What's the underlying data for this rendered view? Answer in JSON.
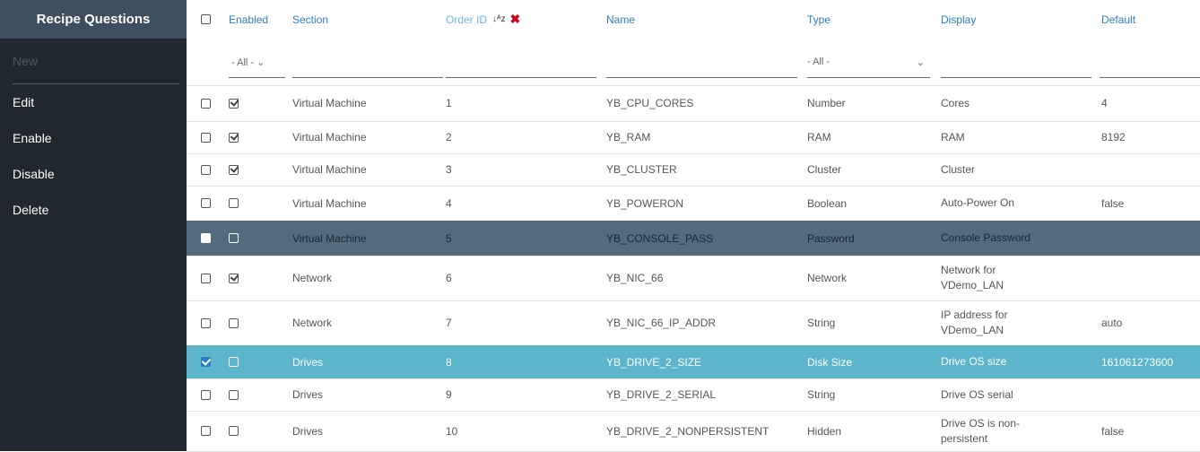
{
  "sidebar": {
    "title": "Recipe Questions",
    "items": [
      {
        "label": "New",
        "enabled": false
      },
      {
        "label": "Edit",
        "enabled": true
      },
      {
        "label": "Enable",
        "enabled": true
      },
      {
        "label": "Disable",
        "enabled": true
      },
      {
        "label": "Delete",
        "enabled": true
      }
    ]
  },
  "columns": {
    "enabled": "Enabled",
    "section": "Section",
    "order_id": "Order ID",
    "name": "Name",
    "type": "Type",
    "display": "Display",
    "default": "Default"
  },
  "filters": {
    "enabled": "- All -",
    "type": "- All -",
    "type_arrow": "⌄",
    "enabled_arrow": "⌄"
  },
  "icons": {
    "sort": "sort-ascending-icon",
    "clear": "clear-sort-icon",
    "sort_glyph": "↓ᴬz",
    "clear_glyph": "✖"
  },
  "colors": {
    "accent": "#2a7fc1",
    "sidebar_bg": "#20272e",
    "sidebar_title_bg": "#3d4e5e",
    "hover_row": "#536c7d",
    "selected_row": "#5cb5ca",
    "clear_icon": "#d0021b"
  },
  "rows": [
    {
      "selected": false,
      "enabled": true,
      "section": "Virtual Machine",
      "order": "1",
      "name": "YB_CPU_CORES",
      "type": "Number",
      "display": "Cores",
      "default": "4",
      "state": ""
    },
    {
      "selected": false,
      "enabled": true,
      "section": "Virtual Machine",
      "order": "2",
      "name": "YB_RAM",
      "type": "RAM",
      "display": "RAM",
      "default": "8192",
      "state": ""
    },
    {
      "selected": false,
      "enabled": true,
      "section": "Virtual Machine",
      "order": "3",
      "name": "YB_CLUSTER",
      "type": "Cluster",
      "display": "Cluster",
      "default": "",
      "state": ""
    },
    {
      "selected": false,
      "enabled": false,
      "section": "Virtual Machine",
      "order": "4",
      "name": "YB_POWERON",
      "type": "Boolean",
      "display": "Auto-Power On",
      "default": "false",
      "state": ""
    },
    {
      "selected": false,
      "enabled": false,
      "section": "Virtual Machine",
      "order": "5",
      "name": "YB_CONSOLE_PASS",
      "type": "Password",
      "display": "Console Password",
      "default": "",
      "state": "hover"
    },
    {
      "selected": false,
      "enabled": true,
      "section": "Network",
      "order": "6",
      "name": "YB_NIC_66",
      "type": "Network",
      "display": "Network for VDemo_LAN",
      "default": "",
      "state": ""
    },
    {
      "selected": false,
      "enabled": false,
      "section": "Network",
      "order": "7",
      "name": "YB_NIC_66_IP_ADDR",
      "type": "String",
      "display": "IP address for VDemo_LAN",
      "default": "auto",
      "state": ""
    },
    {
      "selected": true,
      "enabled": false,
      "section": "Drives",
      "order": "8",
      "name": "YB_DRIVE_2_SIZE",
      "type": "Disk Size",
      "display": "Drive OS size",
      "default": "161061273600",
      "state": "selected"
    },
    {
      "selected": false,
      "enabled": false,
      "section": "Drives",
      "order": "9",
      "name": "YB_DRIVE_2_SERIAL",
      "type": "String",
      "display": "Drive OS serial",
      "default": "",
      "state": ""
    },
    {
      "selected": false,
      "enabled": false,
      "section": "Drives",
      "order": "10",
      "name": "YB_DRIVE_2_NONPERSISTENT",
      "type": "Hidden",
      "display": "Drive OS is non-persistent",
      "default": "false",
      "state": ""
    }
  ]
}
